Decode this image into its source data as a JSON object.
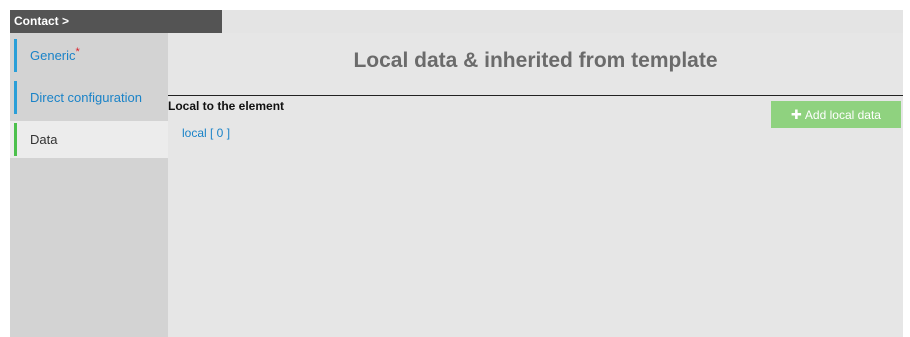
{
  "breadcrumb": {
    "label": "Contact >"
  },
  "sidebar": {
    "items": [
      {
        "label": "Generic",
        "required_mark": "*",
        "state": "inactive"
      },
      {
        "label": "Direct configuration",
        "state": "inactive"
      },
      {
        "label": "Data",
        "state": "active"
      }
    ]
  },
  "main": {
    "title": "Local data & inherited from template",
    "section_label": "Local to the element",
    "local_link": "local [ 0 ]",
    "add_button": {
      "icon": "plus-icon",
      "label": "Add local data"
    }
  },
  "colors": {
    "breadcrumb_bg": "#545454",
    "link": "#1a83c8",
    "active_marker": "#4cc04c",
    "inactive_marker": "#2a9fd8",
    "add_button_bg": "#8fd27f",
    "required_star": "#d9232d"
  }
}
